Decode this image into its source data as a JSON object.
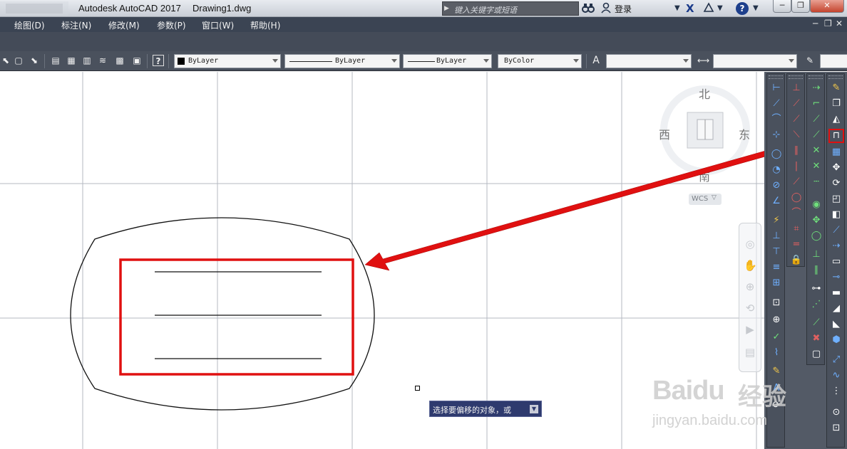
{
  "titlebar": {
    "app_title": "Autodesk AutoCAD 2017",
    "doc_title": "Drawing1.dwg",
    "search_placeholder": "键入关键字或短语",
    "login_label": "登录",
    "help_label": "?"
  },
  "menubar": {
    "items": [
      "绘图(D)",
      "标注(N)",
      "修改(M)",
      "参数(P)",
      "窗口(W)",
      "帮助(H)"
    ]
  },
  "properties": {
    "color": "ByLayer",
    "linetype": "ByLayer",
    "lineweight": "ByLayer",
    "plotstyle": "ByColor"
  },
  "viewcube": {
    "north": "北",
    "south": "南",
    "east": "东",
    "west": "西",
    "wcs_label": "WCS"
  },
  "tooltip": {
    "prompt": "选择要偏移的对象，或"
  },
  "watermark": {
    "brand": "Baidu",
    "brand_cn": "经验",
    "url": "jingyan.baidu.com"
  },
  "colors": {
    "annotation_red": "#e01010",
    "titlebar": "#d6dae0",
    "menubar": "#3b4453",
    "toolbar": "#4a515d",
    "canvas": "#ffffff",
    "tooltip_bg": "#2e3a6e"
  },
  "icons": {
    "search": "binoculars-icon",
    "user": "user-icon",
    "exchange": "exchange-x-icon",
    "a360": "a360-icon",
    "help": "help-icon",
    "minimize": "minimize-icon",
    "restore": "restore-icon",
    "close": "close-icon",
    "offset_tool": "offset-icon"
  }
}
